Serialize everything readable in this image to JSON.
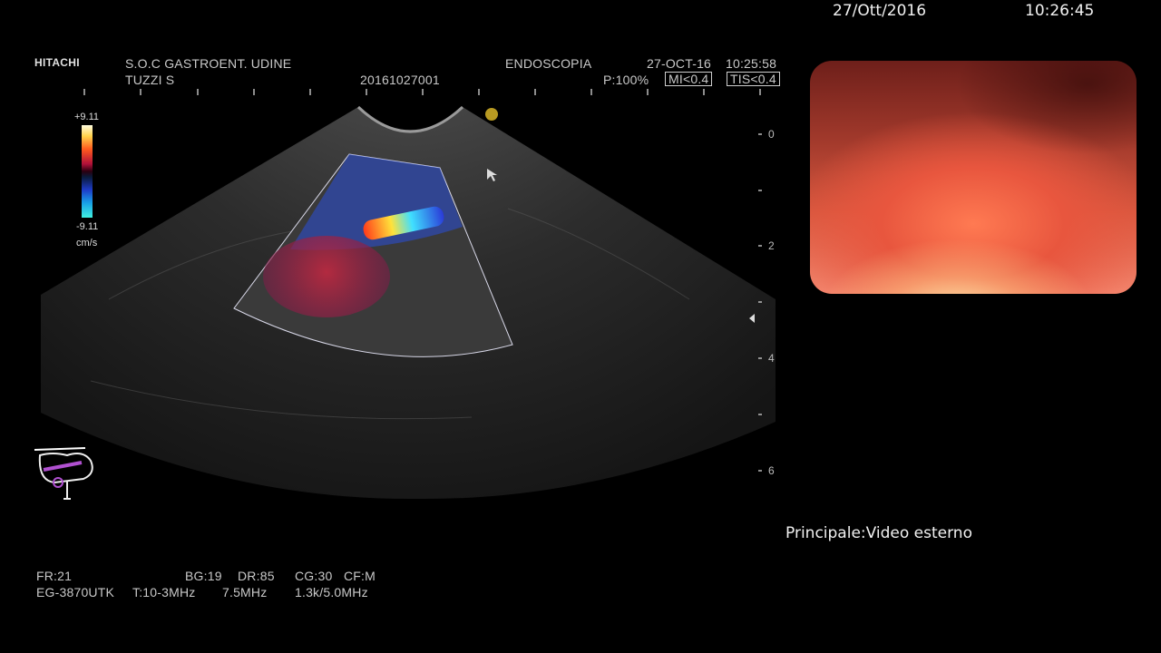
{
  "system": {
    "date": "27/Ott/2016",
    "time": "10:26:45",
    "source_label": "Principale:Video esterno"
  },
  "ultrasound": {
    "brand": "HITACHI",
    "institution": "S.O.C GASTROENT.  UDINE",
    "operator": "TUZZI S",
    "exam_id": "20161027001",
    "mode": "ENDOSCOPIA",
    "date": "27-OCT-16",
    "time": "10:25:58",
    "power": "P:100%",
    "mi": "MI<0.4",
    "tis": "TIS<0.4",
    "scale_max": "+9.11",
    "scale_min": "-9.11",
    "scale_unit": "cm/s",
    "depth_marks": [
      "0",
      "2",
      "4",
      "6"
    ],
    "params_line1": {
      "fr": "FR:21",
      "bg": "BG:19",
      "dr": "DR:85",
      "cg": "CG:30",
      "cf": "CF:M"
    },
    "params_line2": {
      "probe": "EG-3870UTK",
      "transmit": "T:10-3MHz",
      "freq": "7.5MHz",
      "doppler": "1.3k/5.0MHz"
    },
    "colors": {
      "fan": "#3a3a3a",
      "doppler_blue": "#2a4fd8",
      "doppler_red": "#b0283a"
    }
  }
}
